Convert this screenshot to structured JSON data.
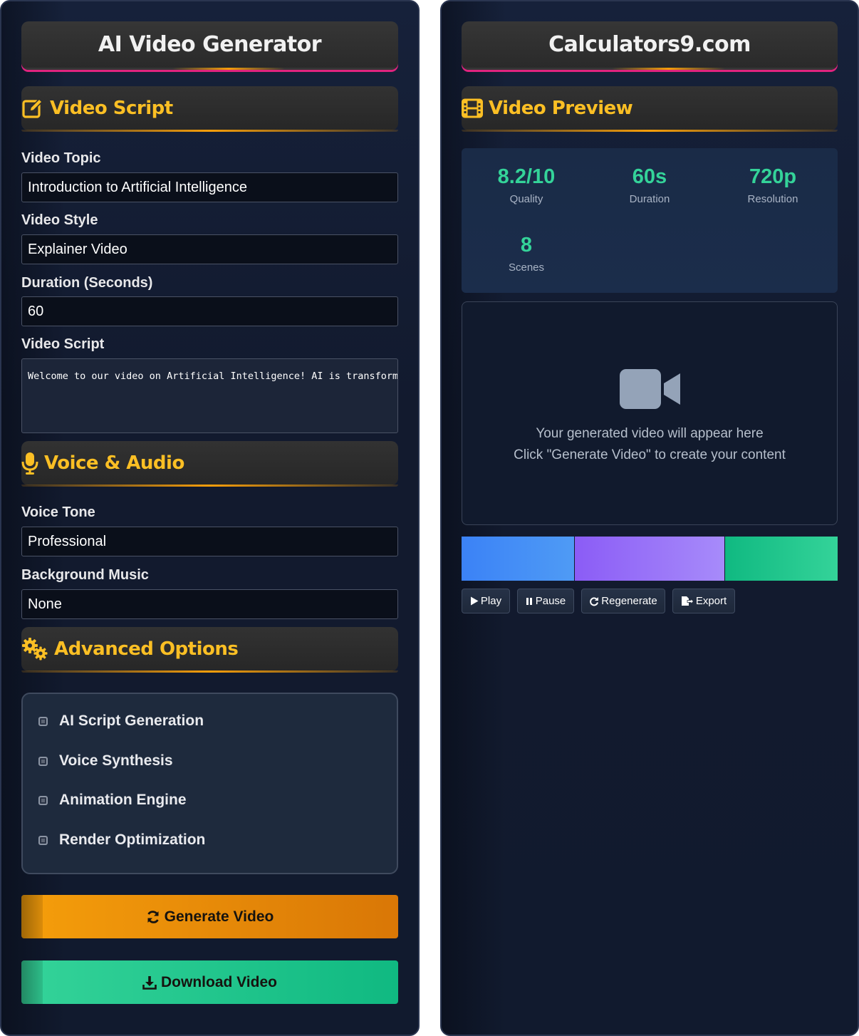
{
  "left": {
    "title": "AI Video Generator",
    "script_section": {
      "title": "Video Script",
      "icon": "edit-icon"
    },
    "fields": {
      "topic": {
        "label": "Video Topic",
        "value": "Introduction to Artificial Intelligence"
      },
      "style": {
        "label": "Video Style",
        "value": "Explainer Video"
      },
      "duration": {
        "label": "Duration (Seconds)",
        "value": "60"
      },
      "script": {
        "label": "Video Script",
        "value": "Welcome to our video on Artificial Intelligence! AI is transforming"
      }
    },
    "voice_section": {
      "title": "Voice & Audio",
      "icon": "microphone-icon"
    },
    "voice_fields": {
      "tone": {
        "label": "Voice Tone",
        "value": "Professional"
      },
      "music": {
        "label": "Background Music",
        "value": "None"
      }
    },
    "advanced_section": {
      "title": "Advanced Options",
      "icon": "gears-icon"
    },
    "options": [
      {
        "label": "AI Script Generation",
        "checked": false
      },
      {
        "label": "Voice Synthesis",
        "checked": false
      },
      {
        "label": "Animation Engine",
        "checked": false
      },
      {
        "label": "Render Optimization",
        "checked": false
      }
    ],
    "generate_label": "Generate Video",
    "download_label": "Download Video"
  },
  "right": {
    "title": "Calculators9.com",
    "preview_section": {
      "title": "Video Preview",
      "icon": "film-icon"
    },
    "stats": [
      {
        "value": "8.2/10",
        "label": "Quality"
      },
      {
        "value": "60s",
        "label": "Duration"
      },
      {
        "value": "720p",
        "label": "Resolution"
      },
      {
        "value": "8",
        "label": "Scenes"
      }
    ],
    "preview": {
      "icon": "video-camera-icon",
      "line1": "Your generated video will appear here",
      "line2": "Click \"Generate Video\" to create your content"
    },
    "timeline_colors": [
      "#3b82f6",
      "#8b5cf6",
      "#10b981"
    ],
    "controls": {
      "play": "Play",
      "pause": "Pause",
      "regenerate": "Regenerate",
      "export": "Export"
    }
  },
  "colors": {
    "accent": "#fbbf24",
    "success": "#34d399",
    "magenta": "#e0237e"
  }
}
